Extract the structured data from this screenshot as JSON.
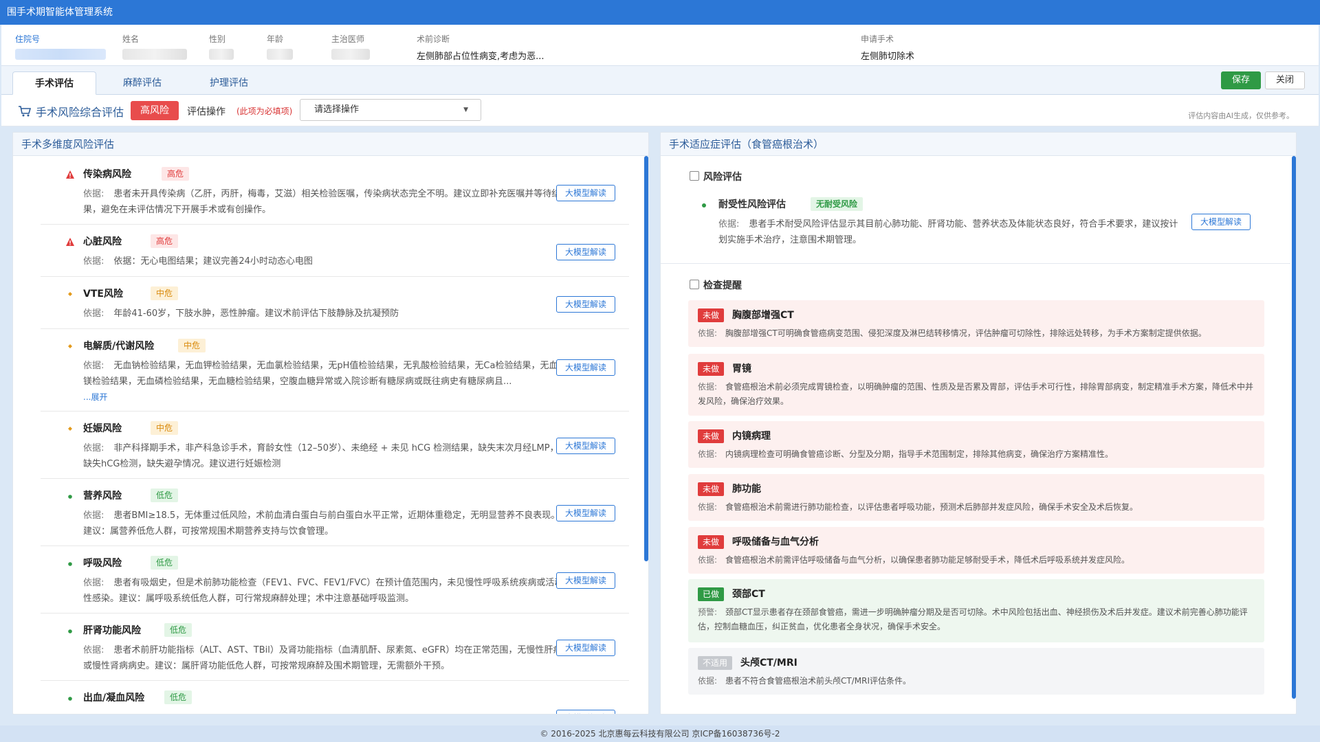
{
  "app": {
    "title": "围手术期智能体管理系统"
  },
  "patient": {
    "labels": {
      "inpatient_no": "住院号",
      "name": "姓名",
      "gender": "性别",
      "age": "年龄",
      "doctor": "主治医师",
      "diagnosis": "术前诊断",
      "surgery": "申请手术"
    },
    "diagnosis": "左侧肺部占位性病变,考虑为恶...",
    "surgery": "左侧肺切除术"
  },
  "tabs": [
    {
      "label": "手术评估"
    },
    {
      "label": "麻醉评估"
    },
    {
      "label": "护理评估"
    }
  ],
  "buttons": {
    "save": "保存",
    "close": "关闭"
  },
  "toolbar": {
    "title": "手术风险综合评估",
    "risk_level": "高风险",
    "op_label": "评估操作",
    "required_note": "(此项为必填项)",
    "select_value": "请选择操作",
    "ai_note": "评估内容由AI生成，仅供参考。"
  },
  "colors": {
    "primary": "#2c77d6",
    "high": "#e84c4c",
    "mid": "#d98a0c",
    "low": "#2f9a45"
  },
  "left_panel": {
    "title": "手术多维度风险评估",
    "basis_label": "依据:",
    "button_label": "大模型解读",
    "expand_label": "...展开",
    "items": [
      {
        "name": "传染病风险",
        "level": "高危",
        "icon": "warning-icon",
        "basis": "患者未开具传染病（乙肝，丙肝，梅毒，艾滋）相关检验医嘱，传染病状态完全不明。建议立即补充医嘱并等待结果，避免在未评估情况下开展手术或有创操作。"
      },
      {
        "name": "心脏风险",
        "level": "高危",
        "icon": "warning-icon",
        "basis": "依据：无心电图结果；建议完善24小时动态心电图"
      },
      {
        "name": "VTE风险",
        "level": "中危",
        "icon": "diamond-icon",
        "basis": "年龄41-60岁，下肢水肿，恶性肿瘤。建议术前评估下肢静脉及抗凝预防"
      },
      {
        "name": "电解质/代谢风险",
        "level": "中危",
        "icon": "diamond-icon",
        "basis": "无血钠检验结果，无血钾检验结果，无血氯检验结果，无pH值检验结果，无乳酸检验结果，无Ca检验结果，无血镁检验结果，无血磷检验结果，无血糖检验结果，空腹血糖异常或入院诊断有糖尿病或既往病史有糖尿病且..."
      },
      {
        "name": "妊娠风险",
        "level": "中危",
        "icon": "diamond-icon",
        "basis": "非产科择期手术，非产科急诊手术，育龄女性（12–50岁）、未绝经 + 未见 hCG 检测结果，缺失末次月经LMP，缺失hCG检测，缺失避孕情况。建议进行妊娠检测"
      },
      {
        "name": "营养风险",
        "level": "低危",
        "icon": "dot-icon",
        "basis": "患者BMI≥18.5，无体重过低风险，术前血清白蛋白与前白蛋白水平正常，近期体重稳定，无明显营养不良表现。建议：属营养低危人群，可按常规围术期营养支持与饮食管理。"
      },
      {
        "name": "呼吸风险",
        "level": "低危",
        "icon": "dot-icon",
        "basis": "患者有吸烟史，但是术前肺功能检查（FEV1、FVC、FEV1/FVC）在预计值范围内，未见慢性呼吸系统疾病或活动性感染。建议：属呼吸系统低危人群，可行常规麻醉处理；术中注意基础呼吸监测。"
      },
      {
        "name": "肝肾功能风险",
        "level": "低危",
        "icon": "dot-icon",
        "basis": "患者术前肝功能指标（ALT、AST、TBil）及肾功能指标（血清肌酐、尿素氮、eGFR）均在正常范围，无慢性肝病或慢性肾病病史。建议：属肝肾功能低危人群，可按常规麻醉及围术期管理，无需额外干预。"
      },
      {
        "name": "出血/凝血风险",
        "level": "低危",
        "icon": "dot-icon",
        "basis": ""
      }
    ]
  },
  "right_panel": {
    "title": "手术适应症评估（食管癌根治术）",
    "risk_section": {
      "title": "风险评估",
      "item_name": "耐受性风险评估",
      "item_badge": "无耐受风险",
      "basis_label": "依据:",
      "basis": "患者手术耐受风险评估显示其目前心肺功能、肝肾功能、营养状态及体能状态良好，符合手术要求，建议按计划实施手术治疗，注意围术期管理。",
      "button_label": "大模型解读"
    },
    "check_section": {
      "title": "检查提醒",
      "items": [
        {
          "status": "未做",
          "name": "胸腹部增强CT",
          "label": "依据:",
          "basis": "胸腹部增强CT可明确食管癌病变范围、侵犯深度及淋巴结转移情况，评估肿瘤可切除性，排除远处转移，为手术方案制定提供依据。"
        },
        {
          "status": "未做",
          "name": "胃镜",
          "label": "依据:",
          "basis": "食管癌根治术前必须完成胃镜检查，以明确肿瘤的范围、性质及是否累及胃部，评估手术可行性，排除胃部病变，制定精准手术方案，降低术中并发风险，确保治疗效果。"
        },
        {
          "status": "未做",
          "name": "内镜病理",
          "label": "依据:",
          "basis": "内镜病理检查可明确食管癌诊断、分型及分期，指导手术范围制定，排除其他病变，确保治疗方案精准性。"
        },
        {
          "status": "未做",
          "name": "肺功能",
          "label": "依据:",
          "basis": "食管癌根治术前需进行肺功能检查，以评估患者呼吸功能，预测术后肺部并发症风险，确保手术安全及术后恢复。"
        },
        {
          "status": "未做",
          "name": "呼吸储备与血气分析",
          "label": "依据:",
          "basis": "食管癌根治术前需评估呼吸储备与血气分析，以确保患者肺功能足够耐受手术，降低术后呼吸系统并发症风险。"
        },
        {
          "status": "已做",
          "name": "颈部CT",
          "label": "预警:",
          "basis": "颈部CT显示患者存在颈部食管癌，需进一步明确肿瘤分期及是否可切除。术中风险包括出血、神经损伤及术后并发症。建议术前完善心肺功能评估，控制血糖血压，纠正贫血，优化患者全身状况，确保手术安全。"
        },
        {
          "status": "不适用",
          "name": "头颅CT/MRI",
          "label": "依据:",
          "basis": "患者不符合食管癌根治术前头颅CT/MRI评估条件。"
        }
      ]
    }
  },
  "footer": {
    "text": "© 2016-2025 北京惠每云科技有限公司 京ICP备16038736号-2"
  }
}
